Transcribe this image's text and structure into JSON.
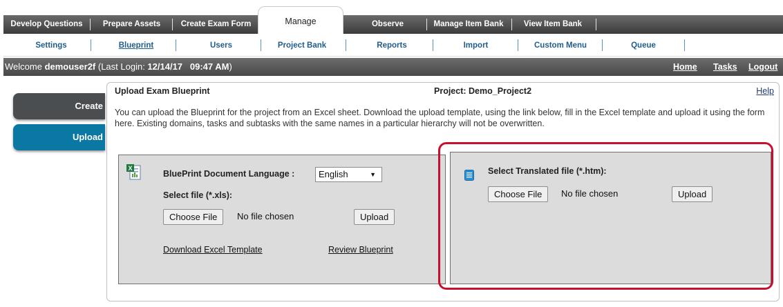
{
  "top_nav": {
    "tabs": [
      {
        "label": "Develop Questions"
      },
      {
        "label": "Prepare Assets"
      },
      {
        "label": "Create Exam Form"
      },
      {
        "label": "Manage"
      },
      {
        "label": "Observe"
      },
      {
        "label": "Manage Item Bank"
      },
      {
        "label": "View Item Bank"
      }
    ],
    "active_tab": "Manage"
  },
  "sub_nav": {
    "items": [
      {
        "label": "Settings"
      },
      {
        "label": "Blueprint"
      },
      {
        "label": "Users"
      },
      {
        "label": "Project Bank"
      },
      {
        "label": "Reports"
      },
      {
        "label": "Import"
      },
      {
        "label": "Custom Menu"
      },
      {
        "label": "Queue"
      }
    ],
    "active_item": "Blueprint"
  },
  "welcome_bar": {
    "prefix": "Welcome ",
    "username": "demouser2f",
    "last_login_label": " (Last Login: ",
    "last_login_value": "12/14/17   09:47 AM",
    "suffix": ")",
    "links": {
      "home": "Home",
      "tasks": "Tasks",
      "logout": "Logout"
    }
  },
  "sidebar": {
    "create_label": "Create",
    "upload_label": "Upload"
  },
  "panel": {
    "title": "Upload Exam Blueprint",
    "project": "Project: Demo_Project2",
    "help": "Help",
    "description": "You can upload the Blueprint for the project from an Excel sheet. Download the upload template, using the link below, fill in the Excel template and upload it using the form here. Existing domains, tasks and subtasks with the same names in a particular hierarchy will not be overwritten."
  },
  "excel_upload": {
    "language_label": "BluePrint Document Language :",
    "language_value": "English",
    "file_label": "Select file (*.xls):",
    "choose_file": "Choose File",
    "no_file": "No file chosen",
    "upload": "Upload",
    "download_template": "Download Excel Template",
    "review_blueprint": "Review Blueprint",
    "icon": "excel-file-icon"
  },
  "translated_upload": {
    "file_label": "Select Translated file (*.htm):",
    "choose_file": "Choose File",
    "no_file": "No file chosen",
    "upload": "Upload",
    "icon": "document-icon"
  },
  "colors": {
    "highlight": "#c8102e",
    "upload_button": "#0b78a3",
    "create_button": "#4a4e50",
    "link_blue": "#1f5d8c"
  }
}
